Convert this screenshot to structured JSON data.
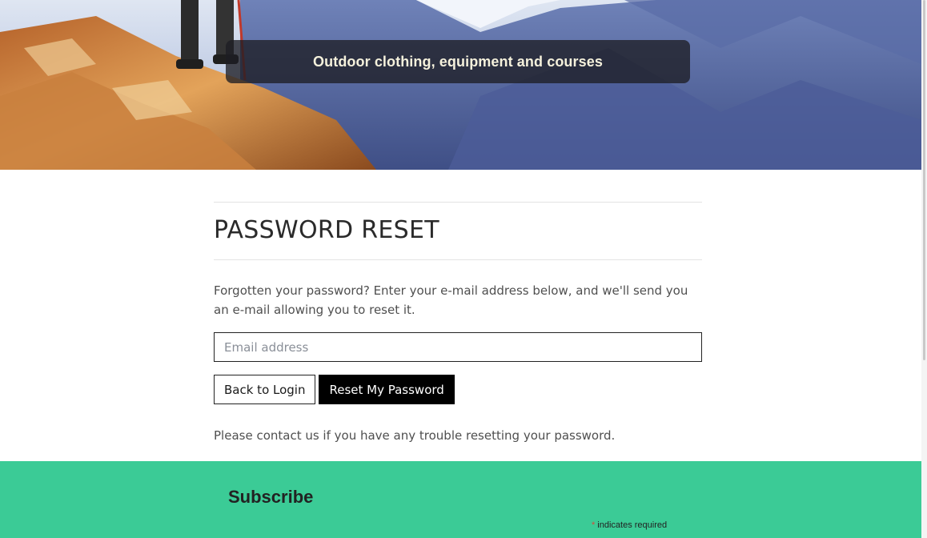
{
  "hero": {
    "caption": "Outdoor clothing, equipment and courses"
  },
  "main": {
    "title": "PASSWORD RESET",
    "intro": "Forgotten your password? Enter your e-mail address below, and we'll send you an e-mail allowing you to reset it.",
    "email": {
      "placeholder": "Email address",
      "value": ""
    },
    "buttons": {
      "back_label": "Back to Login",
      "reset_label": "Reset My Password"
    },
    "help": "Please contact us if you have any trouble resetting your password."
  },
  "subscribe": {
    "title": "Subscribe",
    "required_asterisk": "*",
    "required_note": "indicates required"
  },
  "colors": {
    "subscribe_bg": "#3bcb96",
    "primary_button": "#000000"
  }
}
